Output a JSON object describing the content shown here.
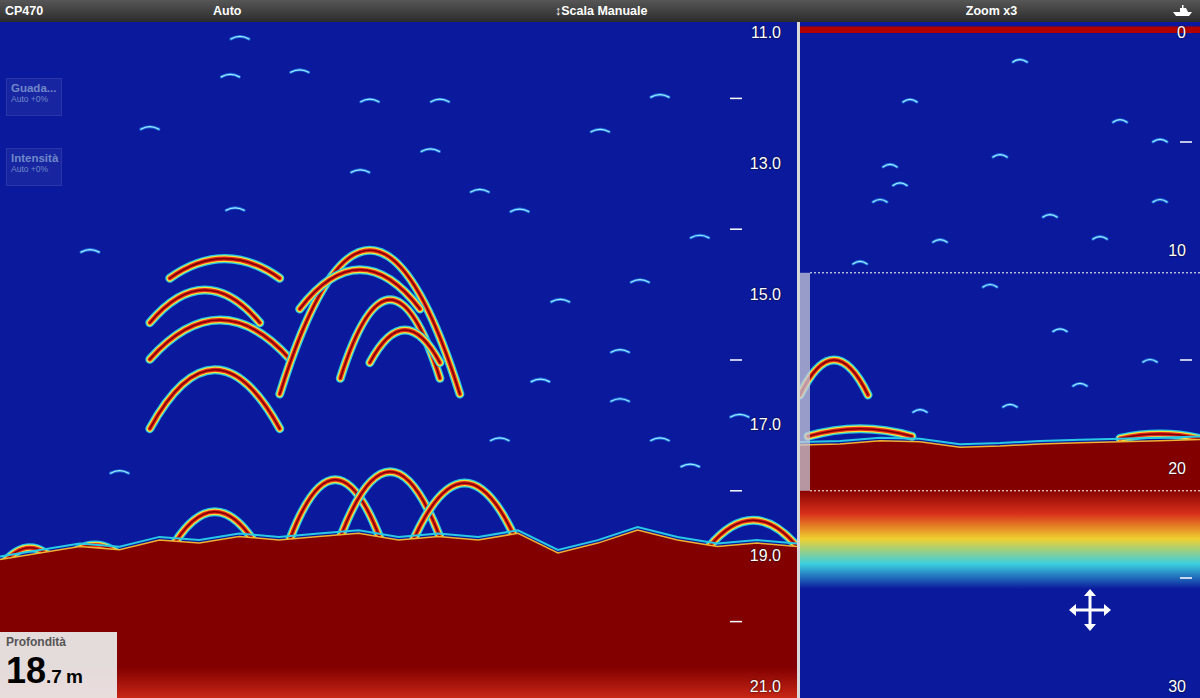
{
  "toolbar": {
    "device": "CP470",
    "mode": "Auto",
    "range_mode": "↕Scala Manuale",
    "zoom": "Zoom x3"
  },
  "settings_overlay": [
    {
      "label": "Guada...",
      "value": "Auto +0%"
    },
    {
      "label": "Intensità",
      "value": "Auto +0%"
    }
  ],
  "depth_readout": {
    "label": "Profondità",
    "whole": "18",
    "fraction": ".7",
    "unit": "m"
  },
  "main_view": {
    "depth_min": 11,
    "depth_max": 21,
    "scale_labels": [
      "11.0",
      "13.0",
      "15.0",
      "17.0",
      "19.0",
      "21.0"
    ],
    "pings": 100,
    "bottom_profile": [
      19.05,
      18.95,
      18.85,
      18.9,
      18.75,
      18.8,
      18.7,
      18.75,
      18.7,
      18.65,
      18.75,
      18.7,
      18.75,
      18.65,
      18.95,
      18.8,
      18.6,
      18.75,
      18.85,
      18.8,
      18.85
    ],
    "bottom_band_end": 20.7,
    "echo_tail_end": 23.0,
    "arches": [
      {
        "start": 21.3,
        "end": 35.1,
        "depth": 14.45,
        "drop": 0.3
      },
      {
        "start": 18.8,
        "end": 32.6,
        "depth": 14.93,
        "drop": 0.5
      },
      {
        "start": 18.8,
        "end": 36.4,
        "depth": 15.39,
        "drop": 0.6
      },
      {
        "start": 18.8,
        "end": 35.1,
        "depth": 16.15,
        "drop": 0.9
      },
      {
        "start": 35.1,
        "end": 57.7,
        "depth": 14.32,
        "drop": 2.2
      },
      {
        "start": 37.6,
        "end": 52.7,
        "depth": 14.62,
        "drop": 0.6
      },
      {
        "start": 42.7,
        "end": 55.2,
        "depth": 15.08,
        "drop": 1.2
      },
      {
        "start": 46.4,
        "end": 55.2,
        "depth": 15.54,
        "drop": 0.5
      },
      {
        "start": 36.4,
        "end": 47.7,
        "depth": 17.83,
        "drop": 0.9
      },
      {
        "start": 42.7,
        "end": 55.2,
        "depth": 17.71,
        "drop": 1.0
      },
      {
        "start": 51.4,
        "end": 65.2,
        "depth": 17.88,
        "drop": 1.0
      },
      {
        "start": 21.3,
        "end": 32.6,
        "depth": 18.32,
        "drop": 0.6
      },
      {
        "start": 7.5,
        "end": 16.3,
        "depth": 18.83,
        "drop": 0.3
      },
      {
        "start": 0,
        "end": 7.5,
        "depth": 18.87,
        "drop": 0.3
      },
      {
        "start": 89,
        "end": 100,
        "depth": 18.45,
        "drop": 0.4
      }
    ],
    "speckles": [
      [
        30.1,
        11.06
      ],
      [
        28.9,
        11.64
      ],
      [
        37.6,
        11.57
      ],
      [
        18.8,
        12.44
      ],
      [
        46.4,
        12.02
      ],
      [
        55.2,
        12.02
      ],
      [
        29.5,
        13.68
      ],
      [
        11.3,
        14.32
      ],
      [
        60.2,
        13.4
      ],
      [
        65.2,
        13.7
      ],
      [
        75.3,
        12.48
      ],
      [
        82.8,
        11.95
      ],
      [
        87.8,
        14.1
      ],
      [
        70.3,
        15.08
      ],
      [
        80.3,
        14.78
      ],
      [
        67.8,
        16.3
      ],
      [
        77.8,
        16.6
      ],
      [
        82.8,
        17.2
      ],
      [
        92.8,
        16.84
      ],
      [
        62.7,
        17.2
      ],
      [
        15,
        17.7
      ],
      [
        77.8,
        15.85
      ],
      [
        54,
        12.78
      ],
      [
        86.6,
        17.6
      ],
      [
        45.2,
        13.1
      ]
    ]
  },
  "zoom_view": {
    "depth_min": 0,
    "depth_max": 30,
    "scale_labels": [
      "0",
      "10",
      "20",
      "30"
    ],
    "pings": 100,
    "surface_band_depth": 0.3,
    "bottom_profile": [
      18.9,
      18.85,
      18.7,
      18.75,
      19.0,
      18.95,
      18.85,
      18.8,
      18.75,
      18.7,
      18.65
    ],
    "bottom_band_end": 20.9,
    "echo_tail_end": 25.5,
    "zoom_window": {
      "depth_min": 11,
      "depth_max": 21
    },
    "arches": [
      {
        "start": 0,
        "end": 17,
        "depth": 15.0,
        "drop": 1.6
      },
      {
        "start": 2,
        "end": 28,
        "depth": 18.15,
        "drop": 0.35
      },
      {
        "start": 80,
        "end": 100,
        "depth": 18.4,
        "drop": 0.2
      }
    ],
    "speckles": [
      [
        55,
        1.24
      ],
      [
        22.5,
        6.05
      ],
      [
        25,
        6.9
      ],
      [
        20,
        7.66
      ],
      [
        80,
        4.0
      ],
      [
        50,
        5.6
      ],
      [
        90,
        7.66
      ],
      [
        75,
        9.36
      ],
      [
        15,
        10.5
      ],
      [
        35,
        9.5
      ],
      [
        62.5,
        8.35
      ],
      [
        47.5,
        11.56
      ],
      [
        65,
        13.6
      ],
      [
        87.5,
        15.0
      ],
      [
        70,
        16.1
      ],
      [
        30,
        17.3
      ],
      [
        52.5,
        17.06
      ],
      [
        27.5,
        3.07
      ],
      [
        90,
        4.9
      ]
    ]
  }
}
